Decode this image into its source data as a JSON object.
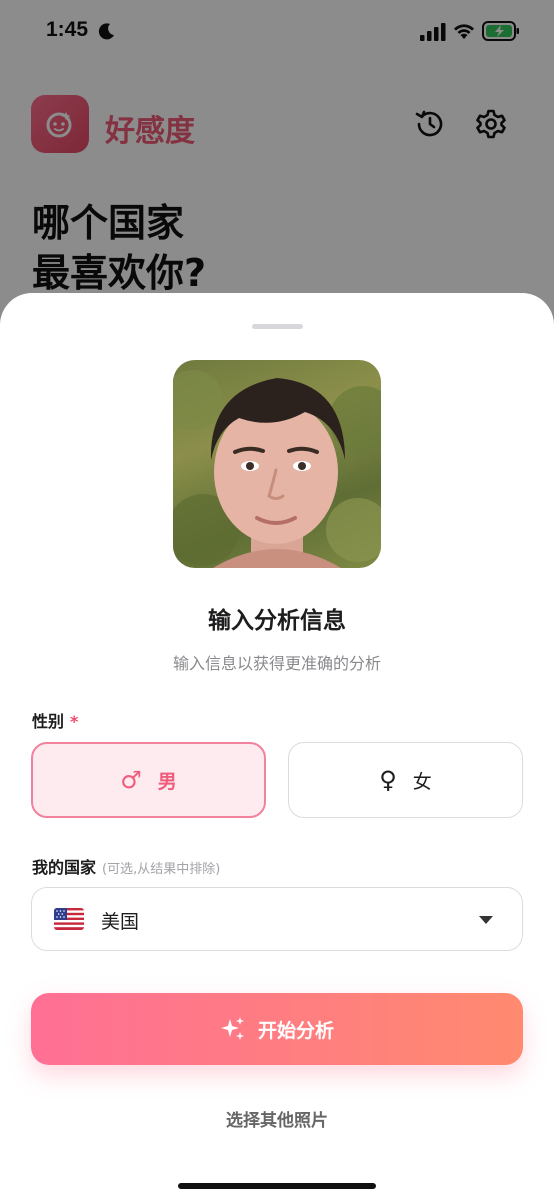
{
  "status_bar": {
    "time": "1:45",
    "icons": [
      "moon-icon",
      "signal-icon",
      "wifi-icon",
      "battery-charging-icon"
    ],
    "battery_color": "#34c759"
  },
  "app": {
    "title": "好感度",
    "brand_color": "#f05a78",
    "logo_icon": "face-icon",
    "history_icon": "history-icon",
    "settings_icon": "gear-icon"
  },
  "hero": {
    "line1": "哪个国家",
    "line2": "最喜欢你?"
  },
  "sheet": {
    "title": "输入分析信息",
    "subtitle": "输入信息以获得更准确的分析",
    "gender": {
      "label": "性别",
      "required_mark": "*",
      "options": [
        {
          "symbol": "♂",
          "label": "男",
          "selected": true
        },
        {
          "symbol": "♀",
          "label": "女",
          "selected": false
        }
      ]
    },
    "country": {
      "label": "我的国家",
      "hint": "(可选,从结果中排除)",
      "selected_flag": "🇺🇸",
      "selected_value": "美国"
    },
    "start_button": {
      "icon": "sparkle-icon",
      "label": "开始分析",
      "gradient": [
        "#ff6f95",
        "#ff8a6f"
      ]
    },
    "other_photo_link": "选择其他照片"
  }
}
